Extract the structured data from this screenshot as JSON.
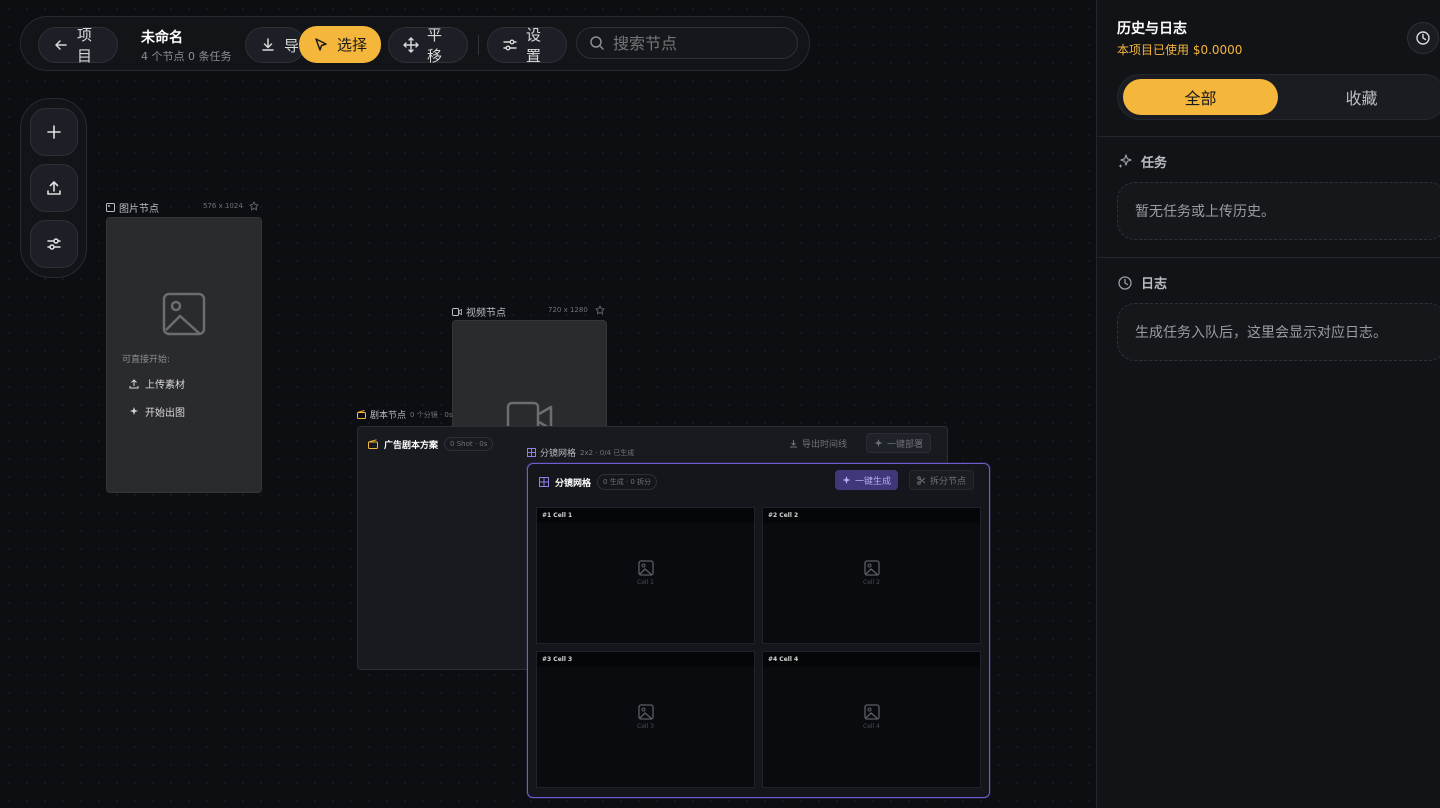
{
  "topbar": {
    "back_label": "项目",
    "project_title": "未命名",
    "project_meta": "4 个节点 0 条任务",
    "export_label": "导",
    "select_label": "选择",
    "pan_label": "平移",
    "settings_label": "设置",
    "search_placeholder": "搜索节点"
  },
  "image_node": {
    "label": "图片节点",
    "dims": "576 x 1024",
    "hint": "可直接开始:",
    "upload_label": "上传素材",
    "generate_label": "开始出图"
  },
  "video_node": {
    "label": "视频节点",
    "dims": "720 x 1280"
  },
  "script_node": {
    "label": "剧本节点",
    "meta": "0 个分镜 · 0s",
    "title": "广告剧本方案",
    "chip": "0 Shot · 0s",
    "export_timeline": "导出时间线",
    "one_click": "一键部署"
  },
  "grid_node": {
    "label": "分镜网格",
    "meta": "2x2 · 0/4 已生成",
    "title": "分镜网格",
    "chip": "0 生成 · 0 拆分",
    "generate_button": "一键生成",
    "split_button": "拆分节点",
    "cells": [
      {
        "tag": "#1 Cell 1",
        "caption": "Cell 1"
      },
      {
        "tag": "#2 Cell 2",
        "caption": "Cell 2"
      },
      {
        "tag": "#3 Cell 3",
        "caption": "Cell 3"
      },
      {
        "tag": "#4 Cell 4",
        "caption": "Cell 4"
      }
    ]
  },
  "panel": {
    "title": "历史与日志",
    "cost": "本项目已使用 $0.0000",
    "tab_all": "全部",
    "tab_fav": "收藏",
    "tasks_title": "任务",
    "tasks_empty": "暂无任务或上传历史。",
    "log_title": "日志",
    "log_empty": "生成任务入队后，这里会显示对应日志。"
  },
  "colors": {
    "accent": "#f5b63c",
    "grid_border": "#6b5fd0",
    "background": "#0c0e12"
  }
}
